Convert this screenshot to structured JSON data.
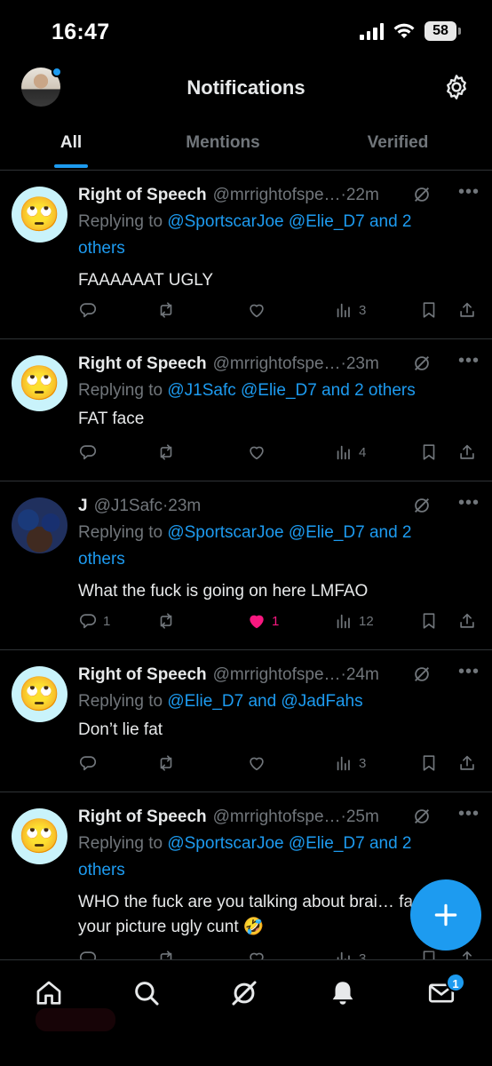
{
  "status_bar": {
    "time": "16:47",
    "battery": "58"
  },
  "header": {
    "title": "Notifications"
  },
  "tabs": [
    {
      "label": "All",
      "active": true
    },
    {
      "label": "Mentions",
      "active": false
    },
    {
      "label": "Verified",
      "active": false
    }
  ],
  "posts": [
    {
      "avatar": "🙄",
      "name": "Right of Speech",
      "handle": "@mrrightofspe…",
      "time": "·22m",
      "replying_prefix": "Replying to ",
      "replying_line1": "@SportscarJoe @Elie_D7 and 2",
      "replying_line2": "others",
      "text": "FAAAAAAT UGLY",
      "replies": "",
      "likes": "",
      "views": "3"
    },
    {
      "avatar": "🙄",
      "name": "Right of Speech",
      "handle": "@mrrightofspe…",
      "time": "·23m",
      "replying_prefix": "Replying to ",
      "replying_line1": "@J1Safc @Elie_D7 and 2 others",
      "replying_line2": "",
      "text": "FAT face",
      "replies": "",
      "likes": "",
      "views": "4"
    },
    {
      "avatar": "",
      "name": "J",
      "handle": "@J1Safc",
      "time": "·23m",
      "replying_prefix": "Replying to ",
      "replying_line1": "@SportscarJoe @Elie_D7 and 2",
      "replying_line2": "others",
      "text": "What the fuck is going on here LMFAO",
      "replies": "1",
      "likes": "1",
      "views": "12"
    },
    {
      "avatar": "🙄",
      "name": "Right of Speech",
      "handle": "@mrrightofspe…",
      "time": "·24m",
      "replying_prefix": "Replying to ",
      "replying_line1": "@Elie_D7 and @JadFahs",
      "replying_line2": "",
      "text": "Don’t lie fat",
      "replies": "",
      "likes": "",
      "views": "3"
    },
    {
      "avatar": "🙄",
      "name": "Right of Speech",
      "handle": "@mrrightofspe…",
      "time": "·25m",
      "replying_prefix": "Replying to ",
      "replying_line1": "@SportscarJoe @Elie_D7 and 2",
      "replying_line2": "others",
      "text": "WHO the fuck are you talking about brai… faces look your picture ugly cunt 🤣",
      "replies": "",
      "likes": "",
      "views": "3"
    }
  ],
  "bottom_nav": {
    "messages_badge": "1"
  },
  "colors": {
    "accent": "#1d9bf0",
    "like": "#f91880",
    "muted": "#71767b",
    "divider": "#2f3336"
  },
  "icons": [
    "gear-icon",
    "grok-icon",
    "more-icon",
    "reply-icon",
    "repost-icon",
    "like-icon",
    "views-icon",
    "bookmark-icon",
    "share-icon",
    "compose-plus-icon",
    "home-icon",
    "search-icon",
    "notifications-bell-icon",
    "messages-icon"
  ]
}
